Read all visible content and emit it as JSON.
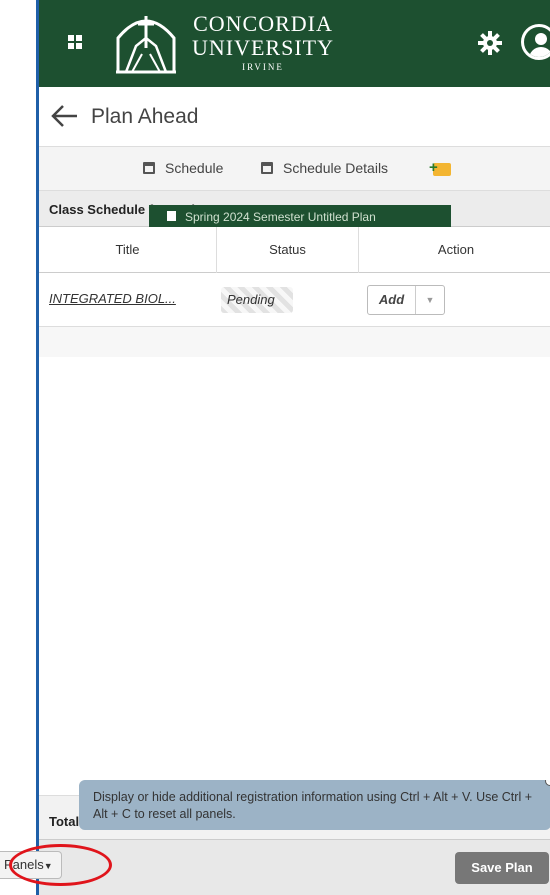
{
  "header": {
    "logo_line1": "CONCORDIA",
    "logo_line2": "UNIVERSITY",
    "logo_line3": "IRVINE",
    "colors": {
      "brand": "#1d5030"
    }
  },
  "titlebar": {
    "title": "Plan Ahead"
  },
  "tabs": [
    {
      "label": "Schedule",
      "icon": "calendar-icon"
    },
    {
      "label": "Schedule Details",
      "icon": "calendar-icon"
    }
  ],
  "schedule": {
    "header_label": "Class Schedule for Spring 2024 Semester",
    "tooltip_text": "Spring 2024 Semester Untitled Plan",
    "columns": [
      "Title",
      "Status",
      "Action"
    ],
    "rows": [
      {
        "title": "INTEGRATED BIOL...",
        "status": "Pending",
        "action": "Add"
      }
    ]
  },
  "totals": {
    "label": "Total"
  },
  "info_tip": {
    "text": "Display or hide additional registration information using Ctrl + Alt + V. Use Ctrl + Alt + C to reset all panels."
  },
  "footer": {
    "panels_label": "Panels",
    "save_label": "Save Plan"
  }
}
